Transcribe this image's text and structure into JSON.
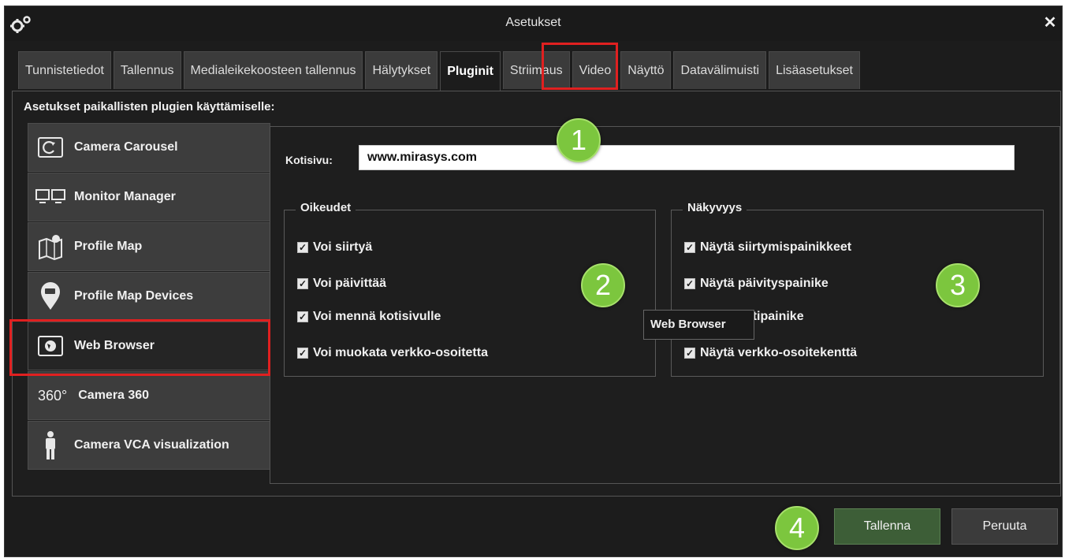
{
  "window": {
    "title": "Asetukset",
    "close_glyph": "✕",
    "app_icon": "gears-icon"
  },
  "tabs": [
    {
      "label": "Tunnistetiedot",
      "active": false
    },
    {
      "label": "Tallennus",
      "active": false
    },
    {
      "label": "Medialeikekoosteen tallennus",
      "active": false
    },
    {
      "label": "Hälytykset",
      "active": false
    },
    {
      "label": "Pluginit",
      "active": true
    },
    {
      "label": "Striimaus",
      "active": false
    },
    {
      "label": "Video",
      "active": false
    },
    {
      "label": "Näyttö",
      "active": false
    },
    {
      "label": "Datavälimuisti",
      "active": false
    },
    {
      "label": "Lisäasetukset",
      "active": false
    }
  ],
  "section_title": "Asetukset paikallisten plugien käyttämiselle:",
  "plugins": [
    {
      "label": "Camera Carousel",
      "icon": "camera-carousel-icon",
      "active": false
    },
    {
      "label": "Monitor Manager",
      "icon": "monitors-icon",
      "active": false
    },
    {
      "label": "Profile Map",
      "icon": "map-icon",
      "active": false
    },
    {
      "label": "Profile Map Devices",
      "icon": "map-pin-icon",
      "active": false
    },
    {
      "label": "Web Browser",
      "icon": "globe-window-icon",
      "active": true
    },
    {
      "label": "Camera 360",
      "icon": "camera-360-icon",
      "icon_text": "360°",
      "active": false
    },
    {
      "label": "Camera VCA visualization",
      "icon": "person-icon",
      "active": false
    }
  ],
  "homepage": {
    "label": "Kotisivu:",
    "value": "www.mirasys.com"
  },
  "permissions": {
    "title": "Oikeudet",
    "items": [
      {
        "label": "Voi siirtyä",
        "checked": true
      },
      {
        "label": "Voi päivittää",
        "checked": true
      },
      {
        "label": "Voi mennä kotisivulle",
        "checked": true
      },
      {
        "label": "Voi muokata verkko-osoitetta",
        "checked": true
      }
    ]
  },
  "visibility": {
    "title": "Näkyvyys",
    "items": [
      {
        "label": "Näytä siirtymispainikkeet",
        "checked": true
      },
      {
        "label": "Näytä päivityspainike",
        "checked": true
      },
      {
        "label": "Näytä kotipainike",
        "checked": true
      },
      {
        "label": "Näytä verkko-osoitekenttä",
        "checked": true
      }
    ]
  },
  "tooltip": "Web Browser",
  "badges": [
    "1",
    "2",
    "3",
    "4"
  ],
  "buttons": {
    "save": "Tallenna",
    "cancel": "Peruuta"
  },
  "colors": {
    "accent_green": "#7cc63e",
    "highlight_red": "#e02020",
    "save_button": "#3d5e37"
  }
}
